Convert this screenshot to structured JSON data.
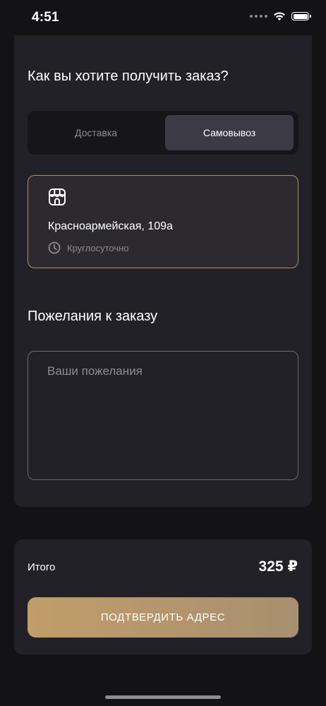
{
  "status_bar": {
    "time": "4:51",
    "icons": [
      "signal-dots-icon",
      "wifi-icon",
      "battery-icon"
    ]
  },
  "order_method": {
    "title": "Как вы хотите получить заказ?",
    "options": [
      {
        "label": "Доставка",
        "selected": false
      },
      {
        "label": "Самовывоз",
        "selected": true
      }
    ]
  },
  "store": {
    "icon": "store-icon",
    "address": "Красноармейская, 109а",
    "hours_icon": "clock-icon",
    "hours": "Круглосуточно"
  },
  "wishes": {
    "title": "Пожелания к заказу",
    "placeholder": "Ваши пожелания",
    "value": ""
  },
  "summary": {
    "total_label": "Итого",
    "total_value": "325 ₽",
    "confirm_label": "ПОДТВЕРДИТЬ АДРЕС"
  },
  "colors": {
    "background": "#131316",
    "card": "#222128",
    "accent_gold": "#c19d6a",
    "muted_text": "#8c8b93",
    "selected_segment": "#3b3a45"
  }
}
